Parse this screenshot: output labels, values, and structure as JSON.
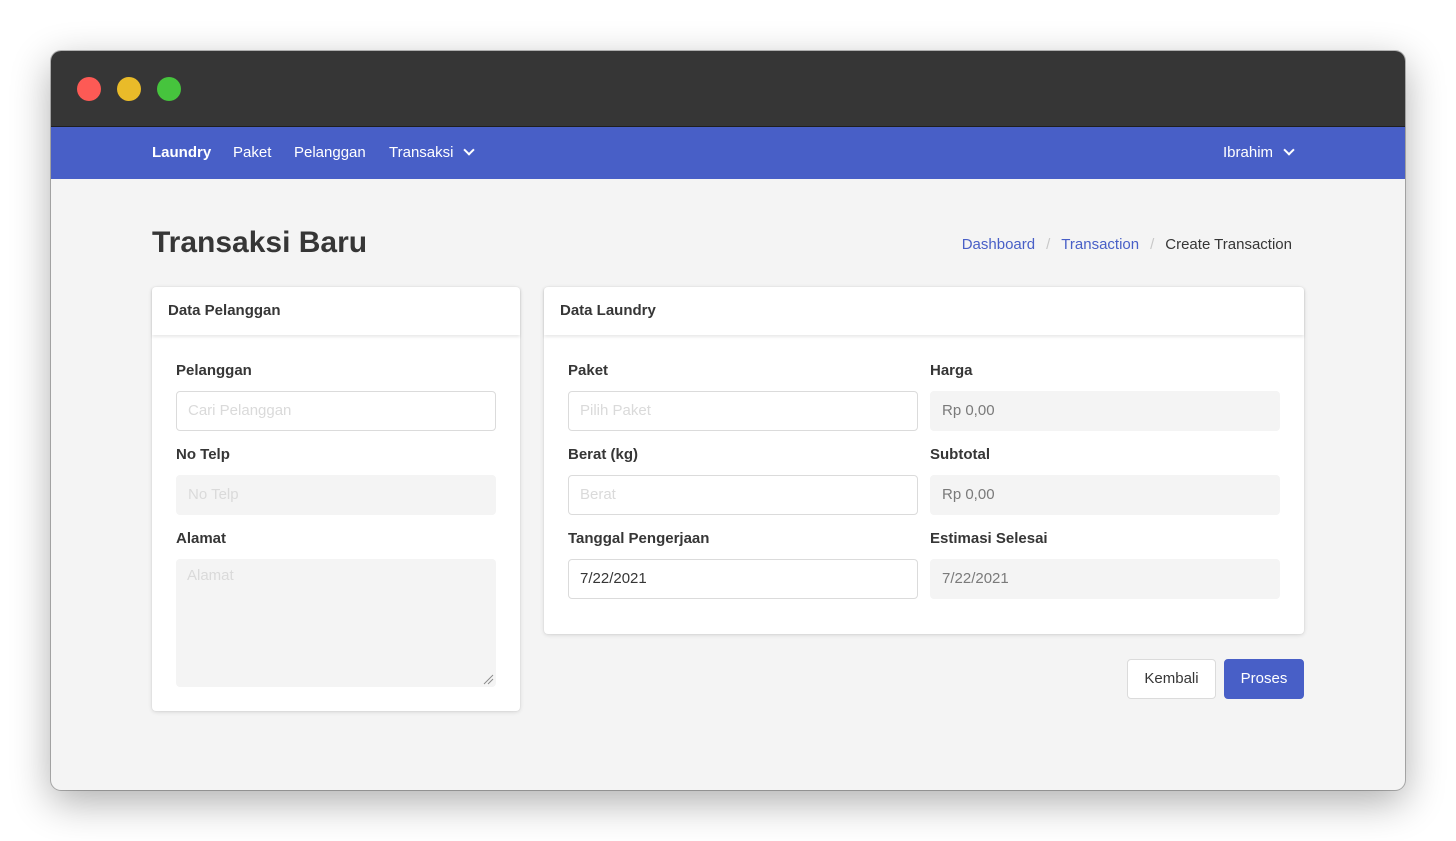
{
  "navbar": {
    "brand": "Laundry",
    "items": [
      "Paket",
      "Pelanggan",
      "Transaksi"
    ],
    "user": "Ibrahim",
    "color": "#485fc7"
  },
  "page": {
    "title": "Transaksi Baru",
    "breadcrumb": [
      "Dashboard",
      "Transaction",
      "Create Transaction"
    ]
  },
  "customer_card": {
    "title": "Data Pelanggan",
    "pelanggan_label": "Pelanggan",
    "pelanggan_placeholder": "Cari Pelanggan",
    "telp_label": "No Telp",
    "telp_placeholder": "No Telp",
    "alamat_label": "Alamat",
    "alamat_placeholder": "Alamat"
  },
  "laundry_card": {
    "title": "Data Laundry",
    "paket_label": "Paket",
    "paket_placeholder": "Pilih Paket",
    "harga_label": "Harga",
    "harga_value": "Rp 0,00",
    "berat_label": "Berat (kg)",
    "berat_placeholder": "Berat",
    "subtotal_label": "Subtotal",
    "subtotal_value": "Rp 0,00",
    "tanggal_label": "Tanggal Pengerjaan",
    "tanggal_value": "7/22/2021",
    "estimasi_label": "Estimasi Selesai",
    "estimasi_value": "7/22/2021"
  },
  "actions": {
    "back": "Kembali",
    "submit": "Proses"
  }
}
